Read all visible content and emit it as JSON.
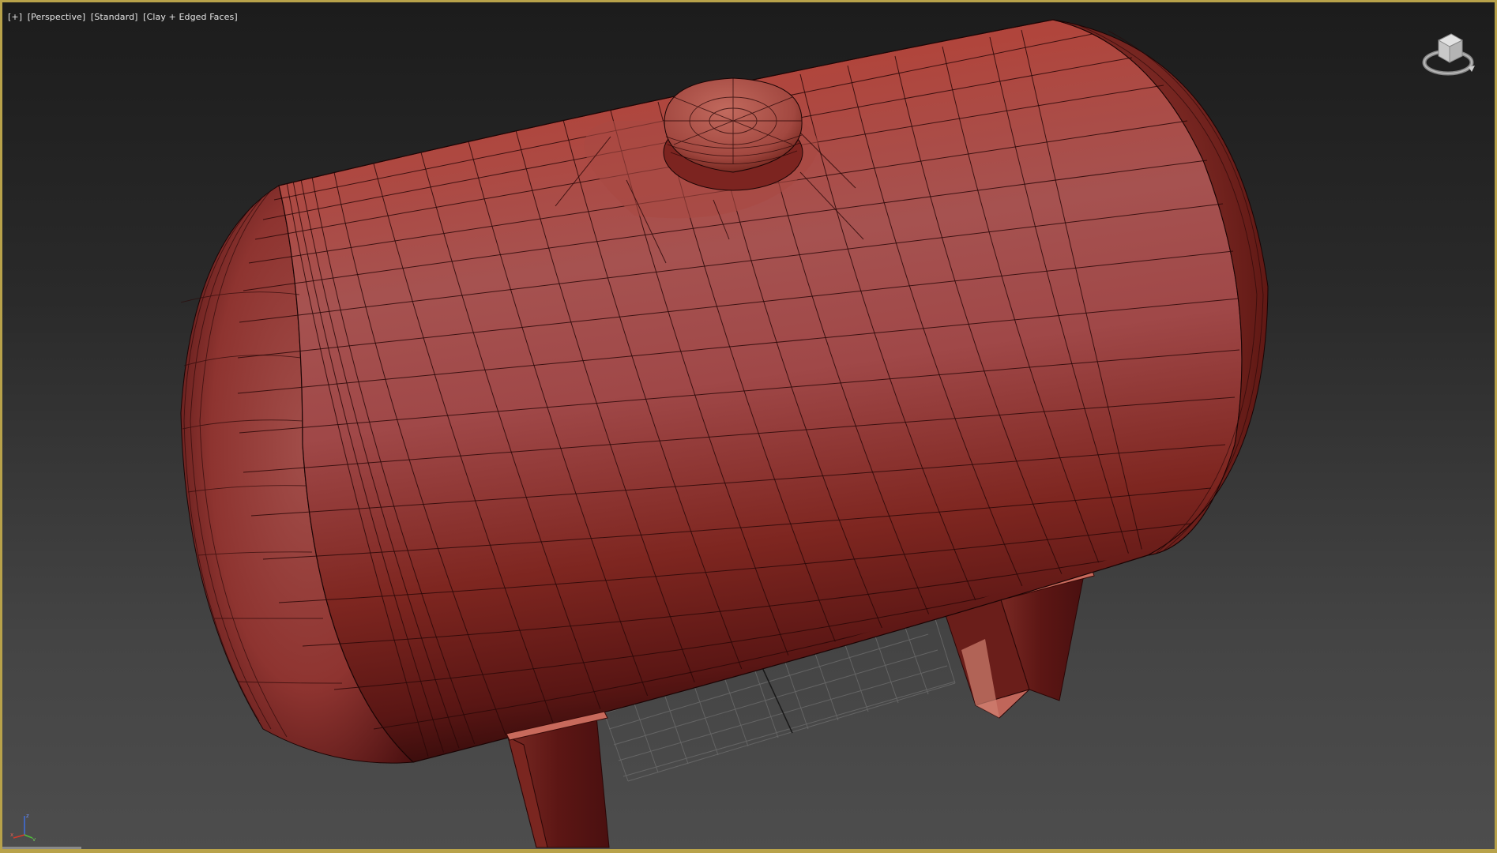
{
  "viewport": {
    "label_parts": [
      "[+]",
      "[Perspective]",
      "[Standard]",
      "[Clay + Edged Faces]"
    ],
    "active_border_color": "#b8a24a",
    "object": {
      "name": "cylindrical-pressure-tank",
      "clay_color": "#b84a40",
      "shadow_color": "#5a1412"
    },
    "viewcube": {
      "icon": "viewcube-icon"
    },
    "axis_tripod": {
      "x": "x",
      "y": "y",
      "z": "z"
    }
  }
}
